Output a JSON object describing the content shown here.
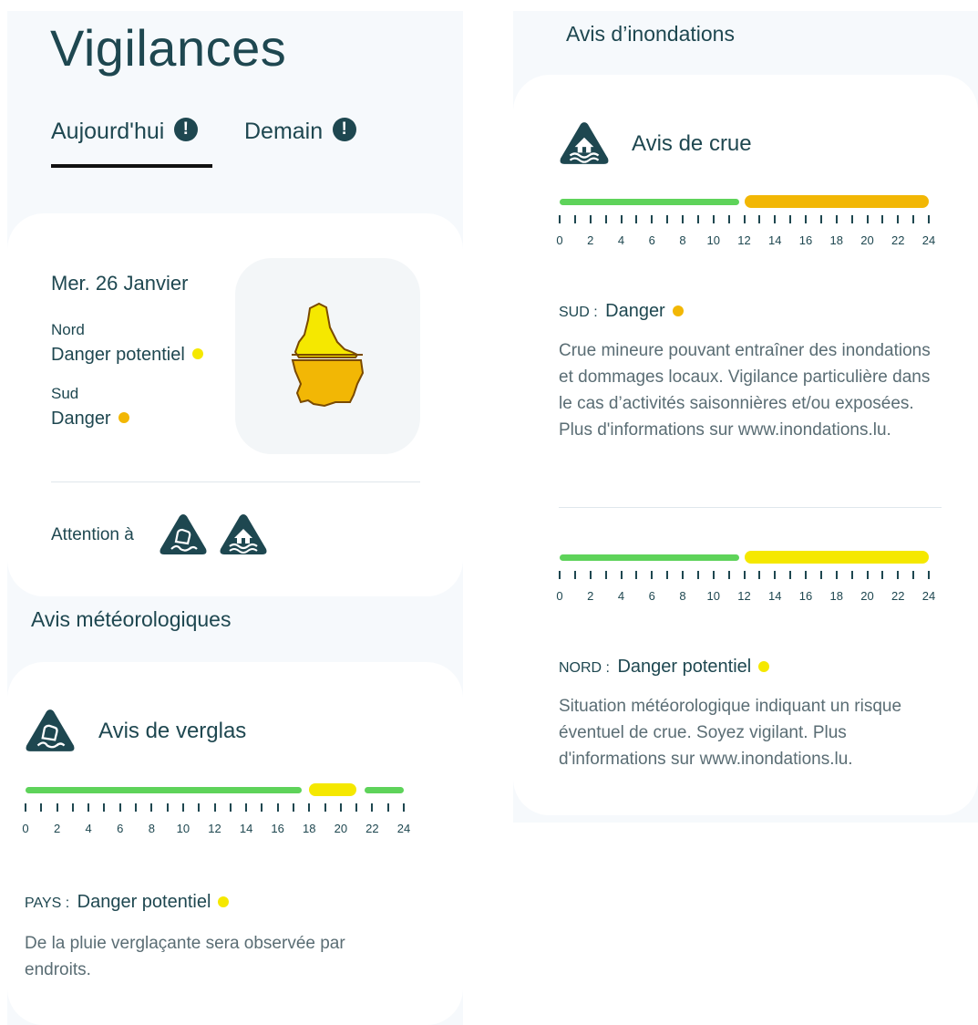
{
  "page": {
    "title": "Vigilances",
    "tabs": [
      {
        "label": "Aujourd'hui",
        "active": true,
        "alert": "!"
      },
      {
        "label": "Demain",
        "active": false,
        "alert": "!"
      }
    ]
  },
  "today": {
    "date": "Mer. 26 Janvier",
    "regions": [
      {
        "name": "Nord",
        "level": "Danger potentiel",
        "color": "#f5e800"
      },
      {
        "name": "Sud",
        "level": "Danger",
        "color": "#f2b705"
      }
    ],
    "map": {
      "north_color": "#f5e800",
      "south_color": "#f2b705"
    },
    "attention_label": "Attention à",
    "attention_icons": [
      "ice-warning-icon",
      "flood-warning-icon"
    ]
  },
  "meteo": {
    "section_title": "Avis météorologiques",
    "alert": {
      "title": "Avis de verglas",
      "icon": "ice-warning-icon",
      "timeline": {
        "segments": [
          {
            "start": 0,
            "end": 17.5,
            "color": "#5ed35a"
          },
          {
            "start": 18,
            "end": 21,
            "color": "#f5e800"
          },
          {
            "start": 21.5,
            "end": 24,
            "color": "#5ed35a"
          }
        ],
        "tick_labels": [
          "0",
          "2",
          "4",
          "6",
          "8",
          "10",
          "12",
          "14",
          "16",
          "18",
          "20",
          "22",
          "24"
        ]
      },
      "region_label": "PAYS :",
      "level": "Danger potentiel",
      "level_color": "#f5e800",
      "description": "De la pluie verglaçante sera observée par endroits."
    }
  },
  "flood": {
    "section_title": "Avis d’inondations",
    "alert_title": "Avis de crue",
    "icon": "flood-warning-icon",
    "entries": [
      {
        "region_label": "SUD :",
        "level": "Danger",
        "level_color": "#f2b705",
        "segments": [
          {
            "start": 0,
            "end": 11.7,
            "color": "#5ed35a"
          },
          {
            "start": 12,
            "end": 24,
            "color": "#f2b705"
          }
        ],
        "tick_labels": [
          "0",
          "2",
          "4",
          "6",
          "8",
          "10",
          "12",
          "14",
          "16",
          "18",
          "20",
          "22",
          "24"
        ],
        "description": "Crue mineure pouvant entraîner des inondations et dommages locaux. Vigilance particulière dans le cas d’activités saisonnières et/ou exposées. Plus d'informations sur www.inondations.lu."
      },
      {
        "region_label": "NORD :",
        "level": "Danger potentiel",
        "level_color": "#f5e800",
        "segments": [
          {
            "start": 0,
            "end": 11.7,
            "color": "#5ed35a"
          },
          {
            "start": 12,
            "end": 24,
            "color": "#f5e800"
          }
        ],
        "tick_labels": [
          "0",
          "2",
          "4",
          "6",
          "8",
          "10",
          "12",
          "14",
          "16",
          "18",
          "20",
          "22",
          "24"
        ],
        "description": "Situation météorologique indiquant un risque éventuel de crue. Soyez vigilant. Plus d'informations sur www.inondations.lu."
      }
    ]
  }
}
